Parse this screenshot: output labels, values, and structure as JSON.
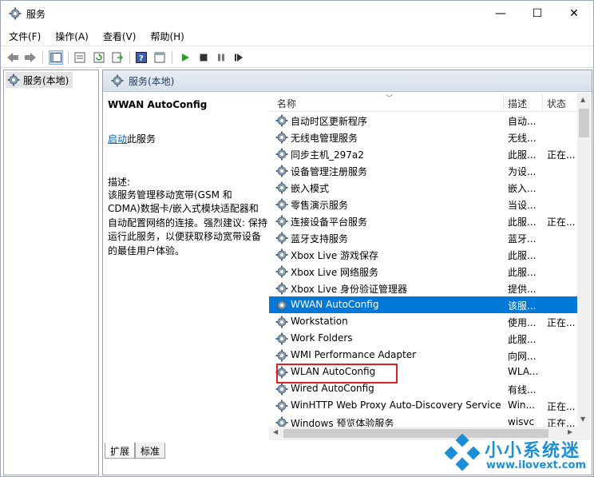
{
  "window": {
    "title": "服务",
    "controls": {
      "minimize": "—",
      "maximize": "☐",
      "close": "✕"
    }
  },
  "menu": [
    "文件(F)",
    "操作(A)",
    "查看(V)",
    "帮助(H)"
  ],
  "toolbar": {
    "buttons": [
      "back-icon",
      "forward-icon",
      "console-tree-icon",
      "properties-icon",
      "refresh-icon",
      "export-icon",
      "help-icon",
      "view-icon",
      "start-icon",
      "stop-icon",
      "pause-icon",
      "restart-icon"
    ]
  },
  "tree": {
    "root": "服务(本地)"
  },
  "pane": {
    "header": "服务(本地)",
    "service_name": "WWAN AutoConfig",
    "start_link": "启动",
    "start_suffix": "此服务",
    "description_label": "描述:",
    "description_text": "该服务管理移动宽带(GSM 和 CDMA)数据卡/嵌入式模块适配器和自动配置网络的连接。强烈建议: 保持运行此服务，以便获取移动宽带设备的最佳用户体验。"
  },
  "columns": {
    "name": "名称",
    "description": "描述",
    "status": "状态"
  },
  "services": [
    {
      "name": "自动时区更新程序",
      "desc": "自动...",
      "status": ""
    },
    {
      "name": "无线电管理服务",
      "desc": "无线...",
      "status": ""
    },
    {
      "name": "同步主机_297a2",
      "desc": "此服...",
      "status": "正在..."
    },
    {
      "name": "设备管理注册服务",
      "desc": "为设...",
      "status": ""
    },
    {
      "name": "嵌入模式",
      "desc": "嵌入...",
      "status": ""
    },
    {
      "name": "零售演示服务",
      "desc": "当设...",
      "status": ""
    },
    {
      "name": "连接设备平台服务",
      "desc": "此服...",
      "status": "正在..."
    },
    {
      "name": "蓝牙支持服务",
      "desc": "蓝牙...",
      "status": ""
    },
    {
      "name": "Xbox Live 游戏保存",
      "desc": "此服...",
      "status": ""
    },
    {
      "name": "Xbox Live 网络服务",
      "desc": "此服...",
      "status": ""
    },
    {
      "name": "Xbox Live 身份验证管理器",
      "desc": "提供...",
      "status": ""
    },
    {
      "name": "WWAN AutoConfig",
      "desc": "该服...",
      "status": "",
      "selected": true
    },
    {
      "name": "Workstation",
      "desc": "使用...",
      "status": "正在..."
    },
    {
      "name": "Work Folders",
      "desc": "此服...",
      "status": ""
    },
    {
      "name": "WMI Performance Adapter",
      "desc": "向网...",
      "status": ""
    },
    {
      "name": "WLAN AutoConfig",
      "desc": "WLA...",
      "status": ""
    },
    {
      "name": "Wired AutoConfig",
      "desc": "有线...",
      "status": ""
    },
    {
      "name": "WinHTTP Web Proxy Auto-Discovery Service",
      "desc": "Win...",
      "status": "正在..."
    },
    {
      "name": "Windows 预览体验服务",
      "desc": "wisvc",
      "status": "正在..."
    }
  ],
  "tabs": [
    "扩展",
    "标准"
  ],
  "watermark": {
    "brand": "小小系统迷",
    "url": "www.ilovext.com"
  },
  "colors": {
    "selection": "#0078d7",
    "highlight_box": "#e02020",
    "link": "#0066cc"
  }
}
